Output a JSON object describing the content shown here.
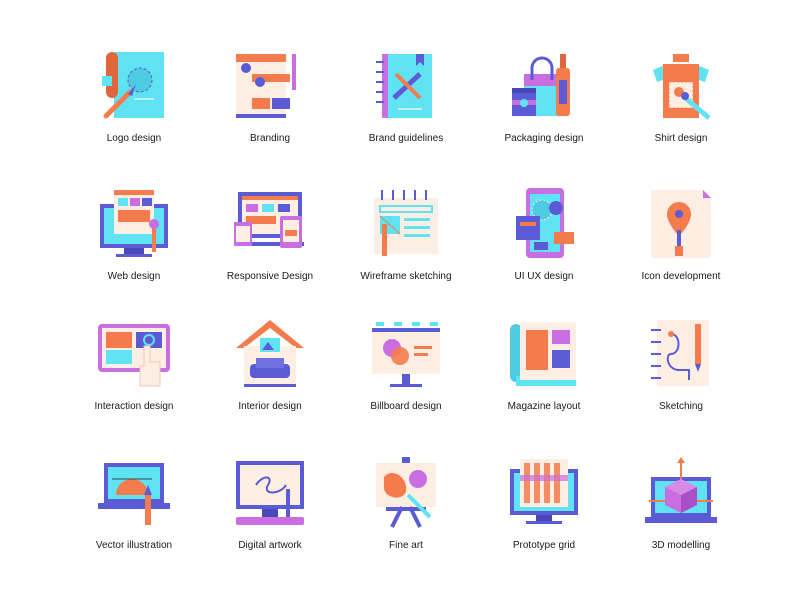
{
  "colors": {
    "cyan": "#5fe3f3",
    "orange": "#f47c4c",
    "indigo": "#5b5bd6",
    "peach": "#fdeee4",
    "violet": "#c96ee0"
  },
  "icons": [
    {
      "label": "Logo design",
      "icon": "logo-design-icon"
    },
    {
      "label": "Branding",
      "icon": "branding-icon"
    },
    {
      "label": "Brand guidelines",
      "icon": "brand-guidelines-icon"
    },
    {
      "label": "Packaging design",
      "icon": "packaging-design-icon"
    },
    {
      "label": "Shirt design",
      "icon": "shirt-design-icon"
    },
    {
      "label": "Web design",
      "icon": "web-design-icon"
    },
    {
      "label": "Responsive Design",
      "icon": "responsive-design-icon"
    },
    {
      "label": "Wireframe sketching",
      "icon": "wireframe-sketching-icon"
    },
    {
      "label": "UI UX design",
      "icon": "ui-ux-design-icon"
    },
    {
      "label": "Icon development",
      "icon": "icon-development-icon"
    },
    {
      "label": "Interaction design",
      "icon": "interaction-design-icon"
    },
    {
      "label": "Interior design",
      "icon": "interior-design-icon"
    },
    {
      "label": "Billboard design",
      "icon": "billboard-design-icon"
    },
    {
      "label": "Magazine layout",
      "icon": "magazine-layout-icon"
    },
    {
      "label": "Sketching",
      "icon": "sketching-icon"
    },
    {
      "label": "Vector illustration",
      "icon": "vector-illustration-icon"
    },
    {
      "label": "Digital artwork",
      "icon": "digital-artwork-icon"
    },
    {
      "label": "Fine art",
      "icon": "fine-art-icon"
    },
    {
      "label": "Prototype grid",
      "icon": "prototype-grid-icon"
    },
    {
      "label": "3D modelling",
      "icon": "3d-modelling-icon"
    }
  ]
}
